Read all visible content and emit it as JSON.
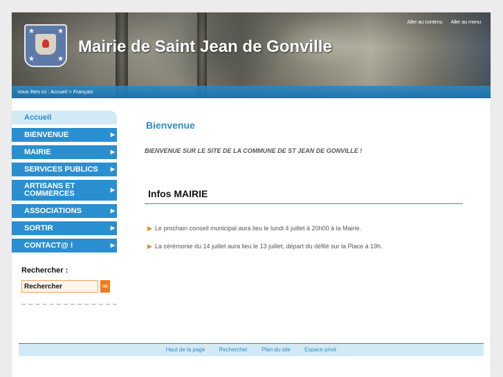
{
  "header": {
    "site_title": "Mairie de Saint Jean de Gonville",
    "skip_links": [
      "Aller au contenu",
      "Aller au menu"
    ]
  },
  "breadcrumb": {
    "prefix": "Vous êtes ici :",
    "home": "Accueil",
    "separator": ">",
    "current": "Français"
  },
  "nav": {
    "home": "Accueil",
    "items": [
      {
        "label": "BIENVENUE"
      },
      {
        "label": "MAIRIE"
      },
      {
        "label": "SERVICES PUBLICS"
      },
      {
        "label": "ARTISANS ET COMMERCES"
      },
      {
        "label": "ASSOCIATIONS"
      },
      {
        "label": "SORTIR"
      },
      {
        "label": "CONTACT@ !"
      }
    ],
    "arrow_icon": "arrow-right-icon"
  },
  "search": {
    "label": "Rechercher :",
    "value": "Rechercher",
    "button": "ok"
  },
  "main": {
    "title": "Bienvenue",
    "welcome": "BIENVENUE SUR LE SITE DE LA COMMUNE DE ST JEAN DE GONVILLE !",
    "infos_title": "Infos MAIRIE",
    "news": [
      "Le prochain conseil municipal aura lieu le lundi 4 juillet à 20h00 à la Mairie.",
      "La cérémonie du 14 juillet aura lieu le 13 juillet, départ du défilé sur la Place à 19h."
    ]
  },
  "footer": {
    "links": [
      "Haut de la page",
      "Rechercher",
      "Plan du site",
      "Espace privé"
    ]
  },
  "colors": {
    "accent": "#2d8bc6",
    "nav_blue": "#2a8fd0",
    "light_blue": "#d2eaf5",
    "orange": "#ef7a1a"
  }
}
